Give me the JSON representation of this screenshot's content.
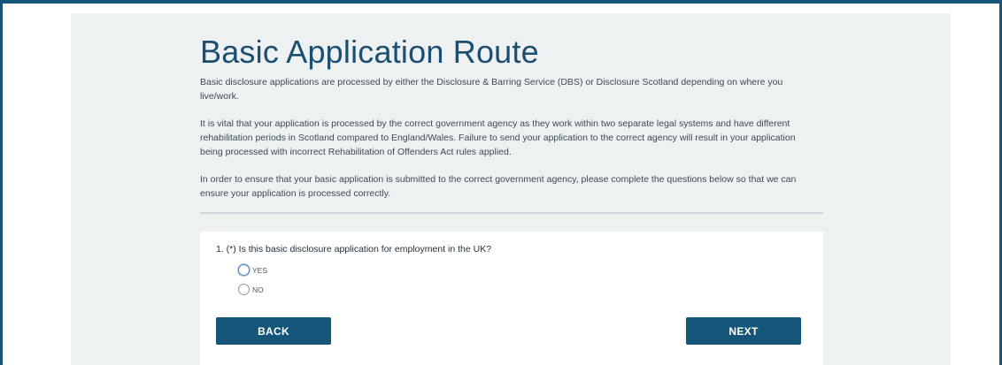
{
  "page": {
    "title": "Basic Application Route",
    "paragraphs": [
      "Basic disclosure applications are processed by either the Disclosure & Barring Service (DBS) or Disclosure Scotland depending on where you live/work.",
      "It is vital that your application is processed by the correct government agency as they work within two separate legal systems and have different rehabilitation periods in Scotland compared to England/Wales. Failure to send your application to the correct agency will result in your application being processed with incorrect Rehabilitation of Offenders Act rules applied.",
      "In order to ensure that your basic application is submitted to the correct government agency, please complete the questions below so that we can ensure your application is processed correctly."
    ]
  },
  "form": {
    "question": "1. (*) Is this basic disclosure application for employment in the UK?",
    "options": [
      {
        "label": "YES",
        "selected": false
      },
      {
        "label": "NO",
        "selected": false
      }
    ],
    "back_label": "BACK",
    "next_label": "NEXT"
  },
  "colors": {
    "brand": "#16557a",
    "title": "#1b4e70",
    "panel_bg": "#eef1f2"
  }
}
